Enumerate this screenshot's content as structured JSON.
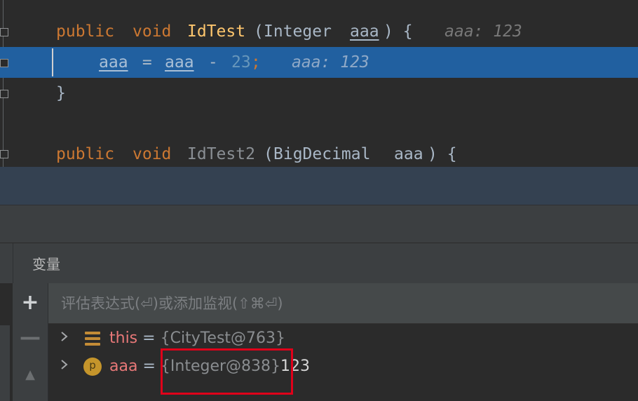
{
  "editor": {
    "line1": {
      "kw1": "public",
      "kw2": "void",
      "method": "IdTest",
      "open": "(",
      "type": "Integer",
      "param": "aaa",
      "close": ") {",
      "hint": "aaa: 123"
    },
    "line2": {
      "lhs": "aaa",
      "op": " = ",
      "rhs": "aaa",
      "minus": " - ",
      "num": "23",
      "semi": ";",
      "hint": "aaa: 123"
    },
    "line3": {
      "brace": "}"
    },
    "line4": {
      "kw1": "public",
      "kw2": "void",
      "method": "IdTest2",
      "open": "(",
      "type": "BigDecimal",
      "param": "aaa",
      "close": ") {"
    }
  },
  "debugger": {
    "panel_title": "变量",
    "toolbar": {
      "add": "+",
      "remove": "—",
      "up": "▲"
    },
    "evaluate_placeholder": "评估表达式(⏎)或添加监视(⇧⌘⏎)",
    "variables": [
      {
        "icon": "field-icon",
        "name": "this",
        "equals": "=",
        "ref": "{CityTest@763}",
        "value": ""
      },
      {
        "icon": "parameter-icon",
        "icon_letter": "p",
        "name": "aaa",
        "equals": "=",
        "ref": "{Integer@838}",
        "value": "123"
      }
    ]
  },
  "colors": {
    "execution_line": "#2160a0",
    "keyword": "#cc7832",
    "method": "#ffc66d",
    "annotation_box": "#e0001a"
  }
}
